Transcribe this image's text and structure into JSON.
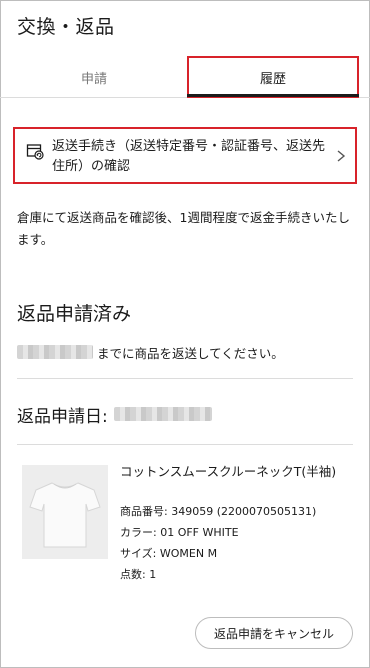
{
  "header": {
    "title": "交換・返品"
  },
  "tabs": [
    {
      "label": "申請"
    },
    {
      "label": "履歴"
    }
  ],
  "procedure": {
    "text": "返送手続き（返送特定番号・認証番号、返送先住所）の確認",
    "icon": "box-return-icon"
  },
  "notice": "倉庫にて返送商品を確認後、1週間程度で返金手続きいたします。",
  "status": {
    "title": "返品申請済み",
    "deadline_text": "までに商品を返送してください。"
  },
  "application_date": {
    "label": "返品申請日:"
  },
  "product": {
    "name": "コットンスムースクルーネックT(半袖)",
    "number": "商品番号: 349059 (2200070505131)",
    "color": "カラー: 01 OFF WHITE",
    "size": "サイズ: WOMEN M",
    "quantity": "点数: 1"
  },
  "cancel_button": {
    "label": "返品申請をキャンセル"
  },
  "colors": {
    "highlight": "#d8232a",
    "text": "#1b1b1b",
    "muted": "#777777"
  }
}
